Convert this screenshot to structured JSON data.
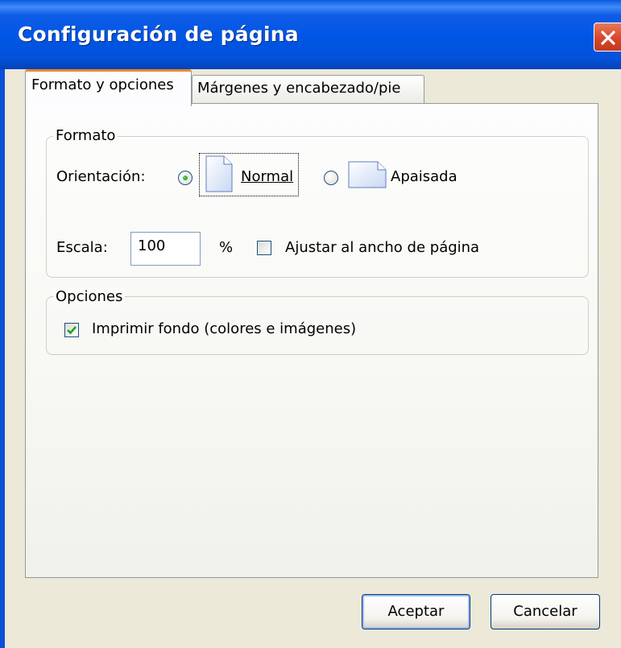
{
  "window": {
    "title": "Configuración de página"
  },
  "tabs": [
    {
      "label": "Formato y opciones",
      "active": true
    },
    {
      "label": "Márgenes y encabezado/pie",
      "active": false
    }
  ],
  "formato": {
    "legend": "Formato",
    "orientation_label": "Orientación:",
    "orientation_options": [
      {
        "label": "Normal",
        "selected": true,
        "icon": "portrait-page-icon"
      },
      {
        "label": "Apaisada",
        "selected": false,
        "icon": "landscape-page-icon"
      }
    ],
    "scale_label": "Escala:",
    "scale_value": "100",
    "scale_unit": "%",
    "fit_width_label": "Ajustar al ancho de página",
    "fit_width_checked": false
  },
  "opciones": {
    "legend": "Opciones",
    "print_background_label": "Imprimir fondo (colores e imágenes)",
    "print_background_checked": true
  },
  "buttons": {
    "ok": "Aceptar",
    "cancel": "Cancelar"
  },
  "colors": {
    "titlebar": "#0055e5",
    "close_button": "#d8462a",
    "active_tab_accent": "#e68b2c",
    "dialog_background": "#ece9d8",
    "check_green": "#21a121"
  }
}
